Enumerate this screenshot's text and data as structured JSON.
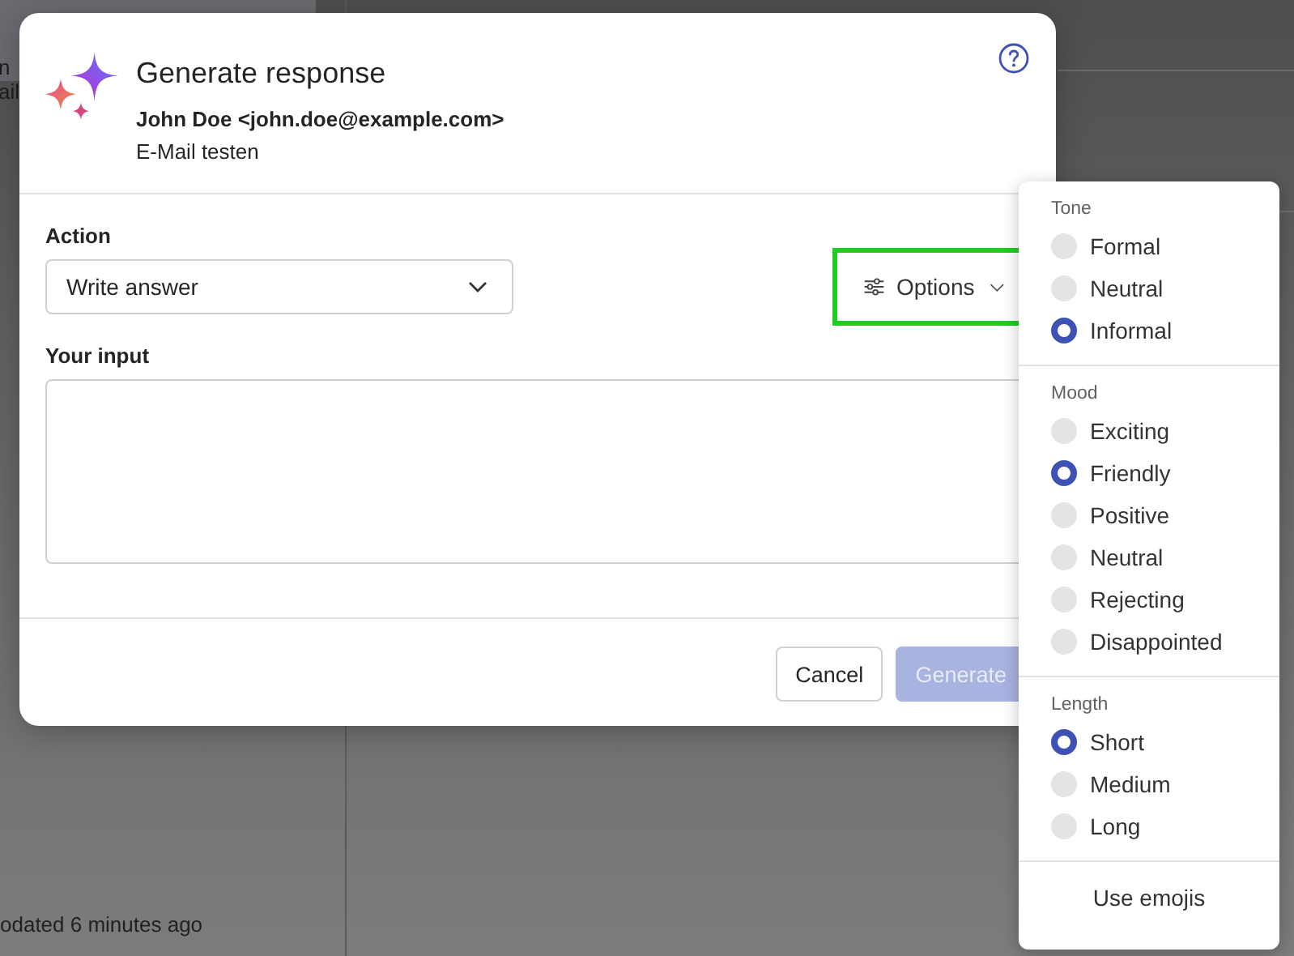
{
  "background": {
    "item_lines": [
      "n",
      "ail"
    ],
    "status": "odated 6 minutes ago"
  },
  "dialog": {
    "title": "Generate response",
    "sender": "John Doe <john.doe@example.com>",
    "subject": "E-Mail testen",
    "action": {
      "label": "Action",
      "value": "Write answer"
    },
    "options_button": {
      "label": "Options",
      "highlighted": true
    },
    "input": {
      "label": "Your input"
    },
    "buttons": [
      {
        "label": "Cancel",
        "kind": "secondary",
        "disabled": false
      },
      {
        "label": "Generate",
        "kind": "primary",
        "disabled": true
      }
    ]
  },
  "options_menu": {
    "groups": [
      {
        "title": "Tone",
        "options": [
          {
            "label": "Formal",
            "selected": false
          },
          {
            "label": "Neutral",
            "selected": false
          },
          {
            "label": "Informal",
            "selected": true
          }
        ]
      },
      {
        "title": "Mood",
        "options": [
          {
            "label": "Exciting",
            "selected": false
          },
          {
            "label": "Friendly",
            "selected": true
          },
          {
            "label": "Positive",
            "selected": false
          },
          {
            "label": "Neutral",
            "selected": false
          },
          {
            "label": "Rejecting",
            "selected": false
          },
          {
            "label": "Disappointed",
            "selected": false
          }
        ]
      },
      {
        "title": "Length",
        "options": [
          {
            "label": "Short",
            "selected": true
          },
          {
            "label": "Medium",
            "selected": false
          },
          {
            "label": "Long",
            "selected": false
          }
        ]
      }
    ],
    "footer": "Use emojis"
  }
}
